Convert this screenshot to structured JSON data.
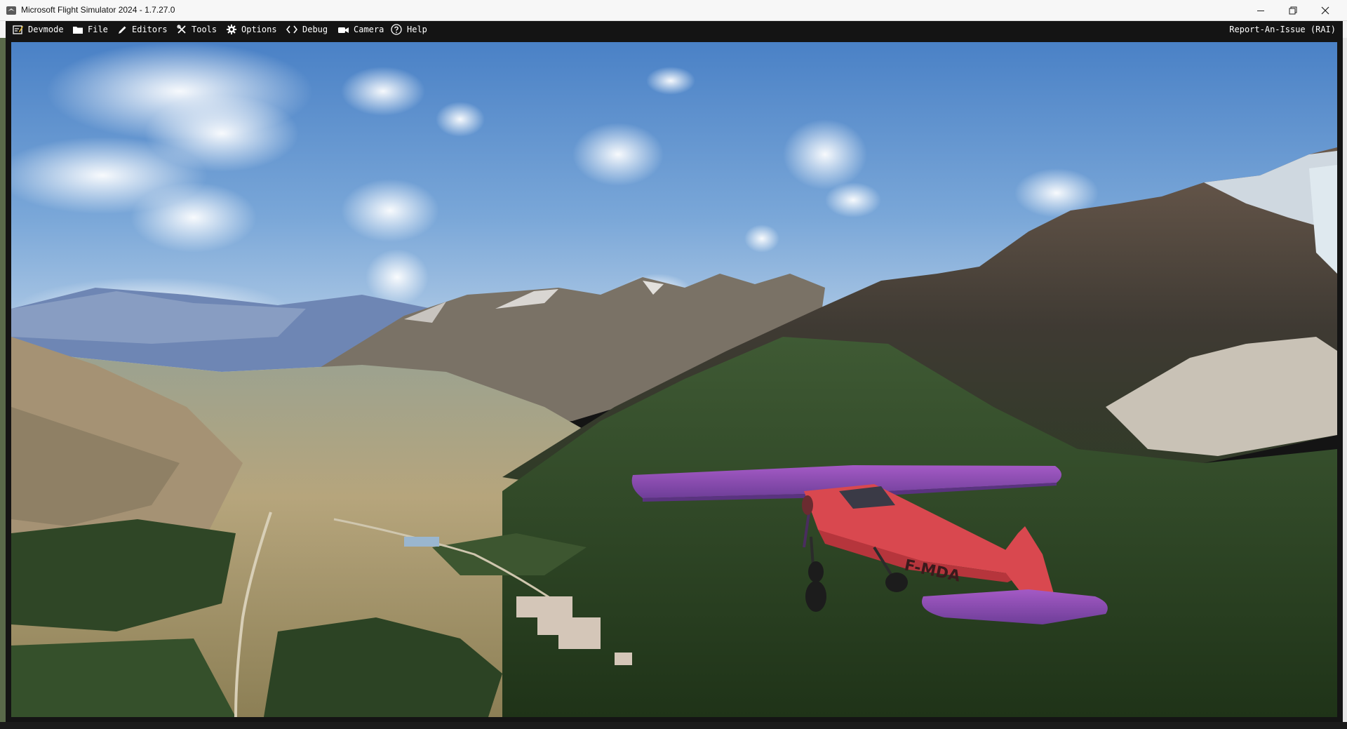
{
  "window": {
    "title": "Microsoft Flight Simulator 2024 - 1.7.27.0",
    "controls": {
      "minimize_icon": "minimize-icon",
      "restore_icon": "restore-icon",
      "close_icon": "close-icon"
    }
  },
  "devbar": {
    "items": [
      {
        "label": "Devmode",
        "icon": "devmode-icon"
      },
      {
        "label": "File",
        "icon": "folder-icon"
      },
      {
        "label": "Editors",
        "icon": "pencil-icon"
      },
      {
        "label": "Tools",
        "icon": "tools-icon"
      },
      {
        "label": "Options",
        "icon": "gear-icon"
      },
      {
        "label": "Debug",
        "icon": "code-icon"
      },
      {
        "label": "Camera",
        "icon": "camera-icon"
      },
      {
        "label": "Help",
        "icon": "help-icon"
      }
    ],
    "report_label": "Report-An-Issue (RAI)"
  },
  "scene": {
    "aircraft_registration": "F-MDA",
    "colors": {
      "sky_top": "#4f86c9",
      "sky_horizon": "#b9d3ea",
      "aircraft_body": "#d9484f",
      "aircraft_wing": "#8a4fb0",
      "forest": "#2f4a25",
      "valley": "#b9a57a"
    }
  }
}
